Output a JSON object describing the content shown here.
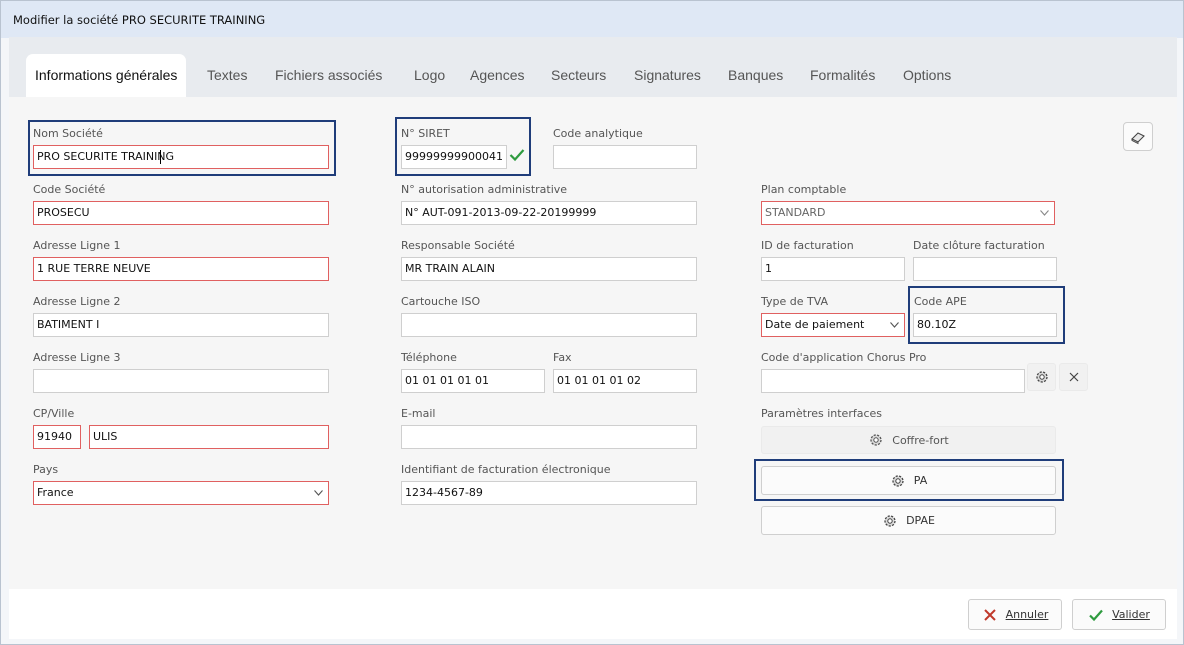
{
  "window": {
    "title": "Modifier la société PRO SECURITE TRAINING"
  },
  "tabs": [
    "Informations générales",
    "Textes",
    "Fichiers associés",
    "Logo",
    "Agences",
    "Secteurs",
    "Signatures",
    "Banques",
    "Formalités",
    "Options"
  ],
  "form": {
    "nom_societe": {
      "label": "Nom Société",
      "value": "PRO SECURITE TRAINING"
    },
    "code_societe": {
      "label": "Code Société",
      "value": "PROSECU"
    },
    "adresse1": {
      "label": "Adresse Ligne 1",
      "value": "1 RUE TERRE NEUVE"
    },
    "adresse2": {
      "label": "Adresse Ligne 2",
      "value": "BATIMENT I"
    },
    "adresse3": {
      "label": "Adresse Ligne 3",
      "value": ""
    },
    "cp_ville": {
      "label": "CP/Ville",
      "cp": "91940",
      "ville": "ULIS"
    },
    "pays": {
      "label": "Pays",
      "value": "France"
    },
    "siret": {
      "label": "N° SIRET",
      "value": "99999999900041"
    },
    "code_analytique": {
      "label": "Code analytique",
      "value": ""
    },
    "autorisation": {
      "label": "N° autorisation administrative",
      "value": "N° AUT-091-2013-09-22-20199999"
    },
    "responsable": {
      "label": "Responsable Société",
      "value": "MR TRAIN ALAIN"
    },
    "cartouche": {
      "label": "Cartouche ISO",
      "value": ""
    },
    "telephone": {
      "label": "Téléphone",
      "value": "01 01 01 01 01"
    },
    "fax": {
      "label": "Fax",
      "value": "01 01 01 01 02"
    },
    "email": {
      "label": "E-mail",
      "value": ""
    },
    "identifiant_facturation": {
      "label": "Identifiant de facturation électronique",
      "value": "1234-4567-89"
    },
    "plan_comptable": {
      "label": "Plan comptable",
      "value": "STANDARD"
    },
    "id_facturation": {
      "label": "ID de facturation",
      "value": "1"
    },
    "date_cloture": {
      "label": "Date clôture facturation",
      "value": ""
    },
    "type_tva": {
      "label": "Type de TVA",
      "value": "Date de paiement"
    },
    "code_ape": {
      "label": "Code APE",
      "value": "80.10Z"
    },
    "chorus": {
      "label": "Code d'application Chorus Pro",
      "value": ""
    },
    "parametres": {
      "label": "Paramètres interfaces"
    }
  },
  "buttons": {
    "coffre_fort": "Coffre-fort",
    "pa": "PA",
    "dpae": "DPAE",
    "annuler": "Annuler",
    "valider": "Valider"
  },
  "icons": {
    "eraser": "eraser-icon",
    "gear": "gear-icon",
    "clear": "close-icon",
    "check": "check-icon",
    "cancel": "cancel-x-icon"
  },
  "colors": {
    "highlight": "#1f3d7a",
    "required_border": "#e06060",
    "check_green": "#2e9b3f",
    "cancel_red": "#c0392b"
  }
}
